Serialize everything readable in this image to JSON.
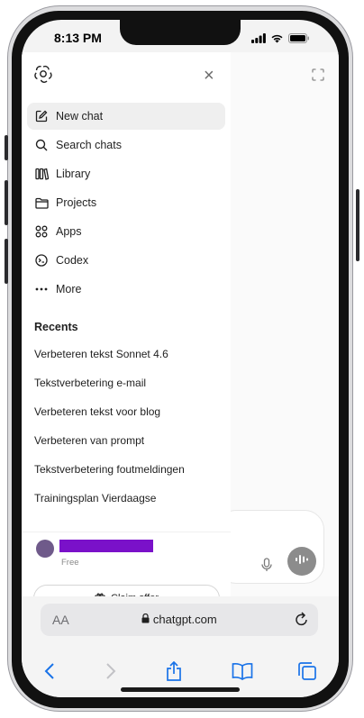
{
  "status_bar": {
    "time": "8:13 PM"
  },
  "sidebar": {
    "menu": [
      {
        "label": "New chat",
        "icon": "edit-icon",
        "active": true
      },
      {
        "label": "Search chats",
        "icon": "search-icon"
      },
      {
        "label": "Library",
        "icon": "library-icon"
      },
      {
        "label": "Projects",
        "icon": "folder-icon"
      },
      {
        "label": "Apps",
        "icon": "apps-icon"
      },
      {
        "label": "Codex",
        "icon": "codex-icon"
      },
      {
        "label": "More",
        "icon": "more-icon"
      }
    ],
    "recents_title": "Recents",
    "recents": [
      "Verbeteren tekst Sonnet 4.6",
      "Tekstverbetering e-mail",
      "Verbeteren tekst voor blog",
      "Verbeteren van prompt",
      "Tekstverbetering foutmeldingen",
      "Trainingsplan Vierdaagse"
    ]
  },
  "profile": {
    "plan": "Free",
    "claim_label": "Claim offer"
  },
  "safari": {
    "aa_label": "AA",
    "url": "chatgpt.com"
  },
  "colors": {
    "accent_blue": "#1a73e8",
    "voice_button": "#8c8c8c",
    "redaction": "#7a11c9"
  }
}
